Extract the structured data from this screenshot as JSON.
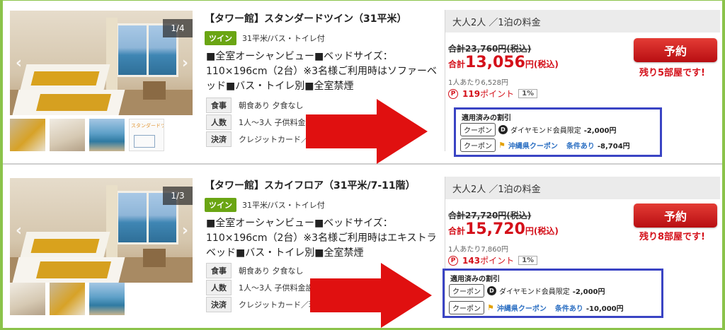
{
  "plans": [
    {
      "photo_counter": "1/4",
      "title": "【タワー館】スタンダードツイン（31平米）",
      "room_type": "ツイン",
      "room_spec": "31平米/バス・トイレ付",
      "description": "■全室オーシャンビュー■ベッドサイズ：110×196cm（2台）※3名様ご利用時はソファーベッド■バス・トイレ別■全室禁煙",
      "meal_label": "食事",
      "meal_value": "朝食あり 夕食なし",
      "guests_label": "人数",
      "guests_value": "1人～3人 子供料金設",
      "payment_label": "決済",
      "payment_value": "クレジットカード／現",
      "price_header": "大人2人 ／1泊の料金",
      "old_price": "合計23,760円(税込)",
      "price_prefix": "合計",
      "price_amount": "13,056",
      "price_suffix": "円(税込)",
      "per_person": "1人あたり6,528円",
      "points_value": "119",
      "points_unit": "ポイント",
      "points_rate": "1%",
      "reserve_label": "予約",
      "rooms_left": "残り5部屋です!",
      "discount_title": "適用済みの割引",
      "discount1_tag": "クーポン",
      "discount1_text": "ダイヤモンド会員限定",
      "discount1_amount": "-2,000円",
      "discount2_tag": "クーポン",
      "discount2_link": "沖縄県クーポン",
      "discount2_cond": "条件あり",
      "discount2_amount": "-8,704円"
    },
    {
      "photo_counter": "1/3",
      "title": "【タワー館】スカイフロア（31平米/7-11階）",
      "room_type": "ツイン",
      "room_spec": "31平米/バス・トイレ付",
      "description": "■全室オーシャンビュー■ベッドサイズ：110×196cm（2台）※3名様ご利用時はエキストラベッド■バス・トイレ別■全室禁煙",
      "meal_label": "食事",
      "meal_value": "朝食あり 夕食なし",
      "guests_label": "人数",
      "guests_value": "1人～3人 子供料金設",
      "payment_label": "決済",
      "payment_value": "クレジットカード／現",
      "price_header": "大人2人 ／1泊の料金",
      "old_price": "合計27,720円(税込)",
      "price_prefix": "合計",
      "price_amount": "15,720",
      "price_suffix": "円(税込)",
      "per_person": "1人あたり7,860円",
      "points_value": "143",
      "points_unit": "ポイント",
      "points_rate": "1%",
      "reserve_label": "予約",
      "rooms_left": "残り8部屋です!",
      "discount_title": "適用済みの割引",
      "discount1_tag": "クーポン",
      "discount1_text": "ダイヤモンド会員限定",
      "discount1_amount": "-2,000円",
      "discount2_tag": "クーポン",
      "discount2_link": "沖縄県クーポン",
      "discount2_cond": "条件あり",
      "discount2_amount": "-10,000円"
    }
  ],
  "thumb_label": "スタンダードツイン",
  "colors": {
    "frame": "#8bc34a",
    "accent_red": "#d4101a",
    "highlight_box": "#3a44c4",
    "arrow": "#e01010",
    "twin_badge": "#6aa513"
  },
  "icons": {
    "points": "P",
    "diamond": "D",
    "flag": "⚑",
    "prev": "‹",
    "next": "›"
  }
}
